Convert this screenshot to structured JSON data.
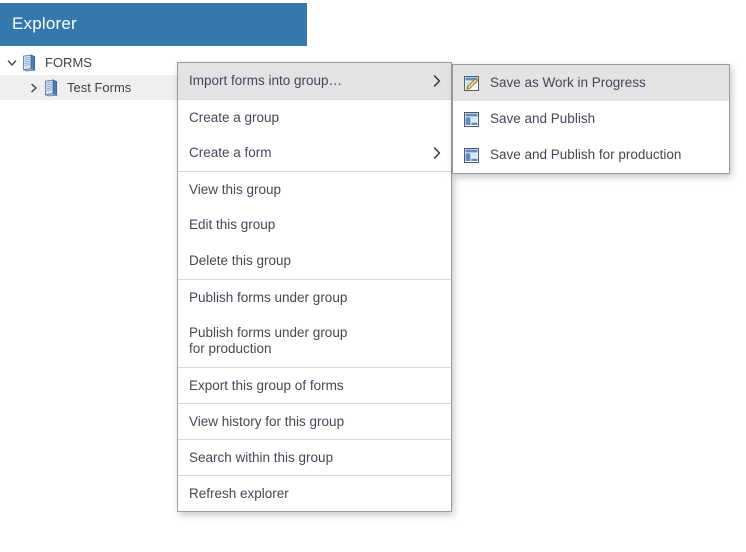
{
  "explorer": {
    "header_title": "Explorer",
    "header_color": "#3478ae",
    "tree": [
      {
        "label": "FORMS",
        "icon": "forms-book-icon",
        "expanded": true,
        "level": 0,
        "selected": false
      },
      {
        "label": "Test Forms",
        "icon": "forms-book-icon",
        "expanded": false,
        "level": 1,
        "selected": true
      }
    ]
  },
  "context_menu": {
    "items": [
      {
        "label": "Import forms into group…",
        "submenu": true,
        "highlight": true,
        "separator_above": false,
        "tall": false
      },
      {
        "label": "Create a group",
        "submenu": false,
        "highlight": false,
        "separator_above": true,
        "tall": false
      },
      {
        "label": "Create a form",
        "submenu": true,
        "highlight": false,
        "separator_above": false,
        "tall": false
      },
      {
        "label": "View this group",
        "submenu": false,
        "highlight": false,
        "separator_above": true,
        "tall": false
      },
      {
        "label": "Edit this group",
        "submenu": false,
        "highlight": false,
        "separator_above": false,
        "tall": false
      },
      {
        "label": "Delete this group",
        "submenu": false,
        "highlight": false,
        "separator_above": false,
        "tall": false
      },
      {
        "label": "Publish forms under group",
        "submenu": false,
        "highlight": false,
        "separator_above": true,
        "tall": false
      },
      {
        "label": "Publish forms under group\nfor production",
        "submenu": false,
        "highlight": false,
        "separator_above": false,
        "tall": true
      },
      {
        "label": "Export this group of forms",
        "submenu": false,
        "highlight": false,
        "separator_above": true,
        "tall": false
      },
      {
        "label": "View history for this group",
        "submenu": false,
        "highlight": false,
        "separator_above": true,
        "tall": false
      },
      {
        "label": "Search within this group",
        "submenu": false,
        "highlight": false,
        "separator_above": true,
        "tall": false
      },
      {
        "label": "Refresh explorer",
        "submenu": false,
        "highlight": false,
        "separator_above": true,
        "tall": false
      }
    ]
  },
  "submenu": {
    "items": [
      {
        "label": "Save as Work in Progress",
        "icon": "document-pencil-icon",
        "highlight": true
      },
      {
        "label": "Save and Publish",
        "icon": "form-document-icon",
        "highlight": false
      },
      {
        "label": "Save and Publish for production",
        "icon": "form-document-icon",
        "highlight": false
      }
    ]
  },
  "colors": {
    "accent_blue": "#3478ae",
    "icon_blue": "#4a7ebb",
    "menu_text": "#464659",
    "menu_border": "#9a9a9a",
    "highlight_bg": "#e3e3e3",
    "tree_selected_bg": "#efefef"
  }
}
